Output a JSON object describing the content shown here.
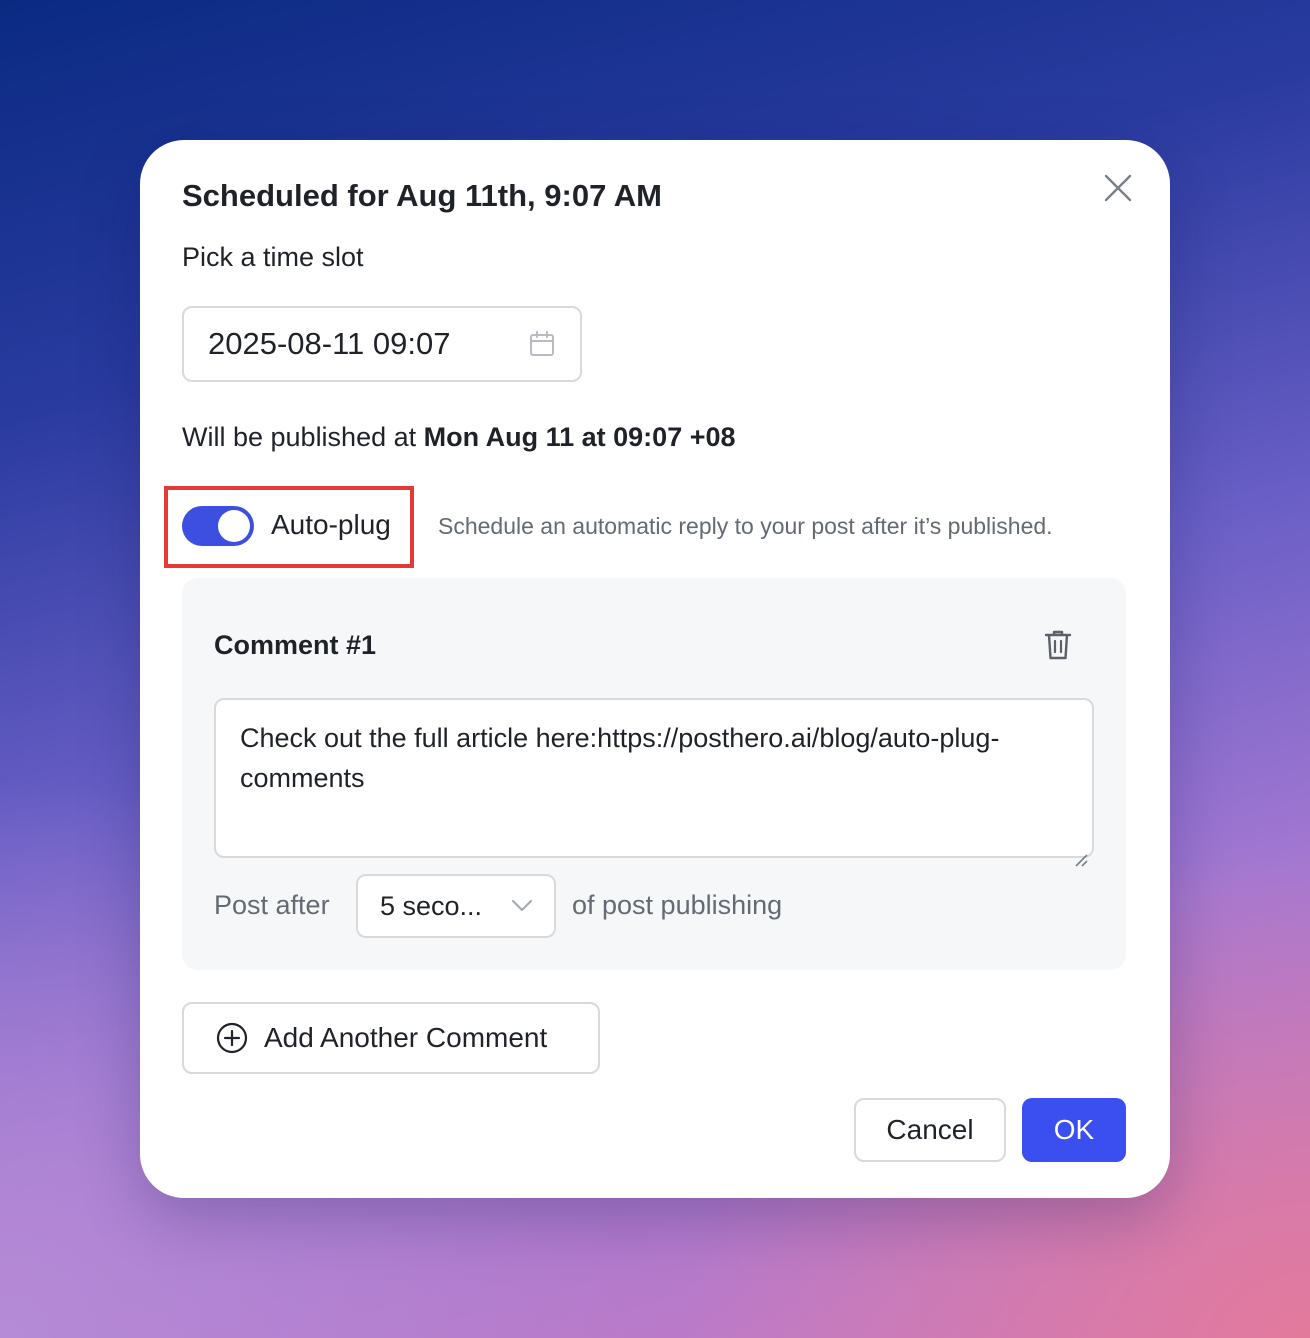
{
  "modal": {
    "title": "Scheduled for Aug 11th, 9:07 AM",
    "subtitle": "Pick a time slot",
    "close_icon": "close-icon"
  },
  "date_picker": {
    "value": "2025-08-11 09:07",
    "icon": "calendar-icon"
  },
  "publish_info": {
    "prefix": "Will be published at ",
    "datetime": "Mon Aug 11 at 09:07 +08"
  },
  "auto_plug": {
    "enabled": true,
    "label": "Auto-plug",
    "description": "Schedule an automatic reply to your post after it’s published.",
    "accent_color": "#3d4fe0",
    "highlight_color": "#e53935"
  },
  "comments": [
    {
      "title": "Comment #1",
      "text": "Check out the full article here:https://posthero.ai/blog/auto-plug-comments",
      "delete_icon": "trash-icon",
      "post_after_label": "Post after",
      "delay_value": "5 seco...",
      "post_after_suffix": "of post publishing"
    }
  ],
  "actions": {
    "add_comment_label": "Add Another Comment",
    "add_comment_icon": "plus-circle-icon",
    "cancel_label": "Cancel",
    "ok_label": "OK",
    "ok_color": "#3b4ef0"
  }
}
